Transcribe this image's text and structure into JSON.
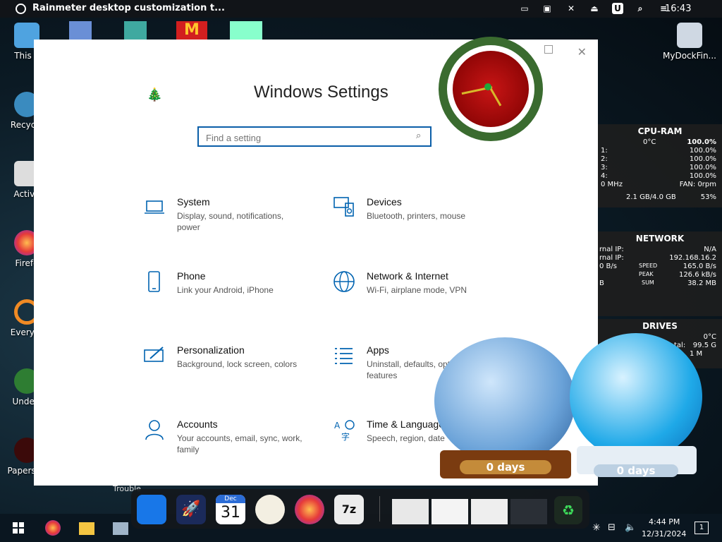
{
  "topbar": {
    "title": "Rainmeter desktop customization t...",
    "clock": "16:43",
    "icons": [
      "cast-icon",
      "monitor-icon",
      "mute-icon",
      "eject-icon",
      "u-badge-icon",
      "search-icon",
      "control-center-icon"
    ]
  },
  "desktop_icons": [
    {
      "label": "This P",
      "icon": "computer-icon"
    },
    {
      "label": "Recycle",
      "icon": "recycle-bin-icon"
    },
    {
      "label": "Activa",
      "icon": "document-icon"
    },
    {
      "label": "Firefo",
      "icon": "firefox-icon"
    },
    {
      "label": "Everyth",
      "icon": "magnifier-icon"
    },
    {
      "label": "Undert",
      "icon": "game-icon"
    },
    {
      "label": "Papers, P",
      "icon": "passport-icon"
    },
    {
      "label": "MyDockFin...",
      "icon": "drive-icon"
    }
  ],
  "settings": {
    "title": "Windows Settings",
    "search_placeholder": "Find a setting",
    "categories": [
      {
        "name": "System",
        "desc": "Display, sound, notifications, power",
        "icon": "laptop-icon"
      },
      {
        "name": "Devices",
        "desc": "Bluetooth, printers, mouse",
        "icon": "devices-icon"
      },
      {
        "name": "Phone",
        "desc": "Link your Android, iPhone",
        "icon": "phone-icon"
      },
      {
        "name": "Network & Internet",
        "desc": "Wi-Fi, airplane mode, VPN",
        "icon": "globe-icon"
      },
      {
        "name": "Personalization",
        "desc": "Background, lock screen, colors",
        "icon": "paintbrush-icon"
      },
      {
        "name": "Apps",
        "desc": "Uninstall, defaults, optional features",
        "icon": "apps-list-icon"
      },
      {
        "name": "Accounts",
        "desc": "Your accounts, email, sync, work, family",
        "icon": "person-icon"
      },
      {
        "name": "Time & Language",
        "desc": "Speech, region, date",
        "icon": "time-language-icon"
      }
    ]
  },
  "cpu_ram": {
    "title": "CPU-RAM",
    "temp": "0°C",
    "total": "100.0%",
    "cores": [
      {
        "label": "1:",
        "value": "100.0%"
      },
      {
        "label": "2:",
        "value": "100.0%"
      },
      {
        "label": "3:",
        "value": "100.0%"
      },
      {
        "label": "4:",
        "value": "100.0%"
      }
    ],
    "freq": "0 MHz",
    "fan": "FAN: 0rpm",
    "ram": "2.1 GB/4.0 GB",
    "ram_pct": "53%"
  },
  "network": {
    "title": "NETWORK",
    "internal_ip_label": "rnal IP:",
    "internal_ip": "N/A",
    "external_ip_label": "rnal IP:",
    "external_ip": "192.168.16.2",
    "speed_left": "0 B/s",
    "speed_label": "SPEED",
    "speed_value": "165.0 B/s",
    "peak_label": "PEAK",
    "peak_value": "126.6 kB/s",
    "sum_left": "B",
    "sum_label": "SUM",
    "sum_value": "38.2 MB"
  },
  "drives": {
    "title": "DRIVES",
    "temp": "0°C",
    "total_label": "tal:",
    "total_value": "99.5 G",
    "line2": "1 M"
  },
  "widgets": {
    "snowglobe_left": "0 days",
    "snowglobe_right": "0 days"
  },
  "dock": {
    "calendar_month": "Dec",
    "calendar_day": "31",
    "apps": [
      "finder-icon",
      "rocket-icon",
      "calendar-icon",
      "clock-icon",
      "firefox-icon",
      "7zip-icon"
    ],
    "thumbs": [
      "window-thumb-1",
      "window-thumb-2",
      "window-thumb-3",
      "window-thumb-4"
    ]
  },
  "taskbar": {
    "time": "4:44 PM",
    "date": "12/31/2024",
    "notification_count": "1"
  },
  "desktop_partial_labels": {
    "trouble": "Trouble"
  },
  "colors": {
    "accent": "#0a5ea8",
    "icon_blue": "#0063b1"
  }
}
